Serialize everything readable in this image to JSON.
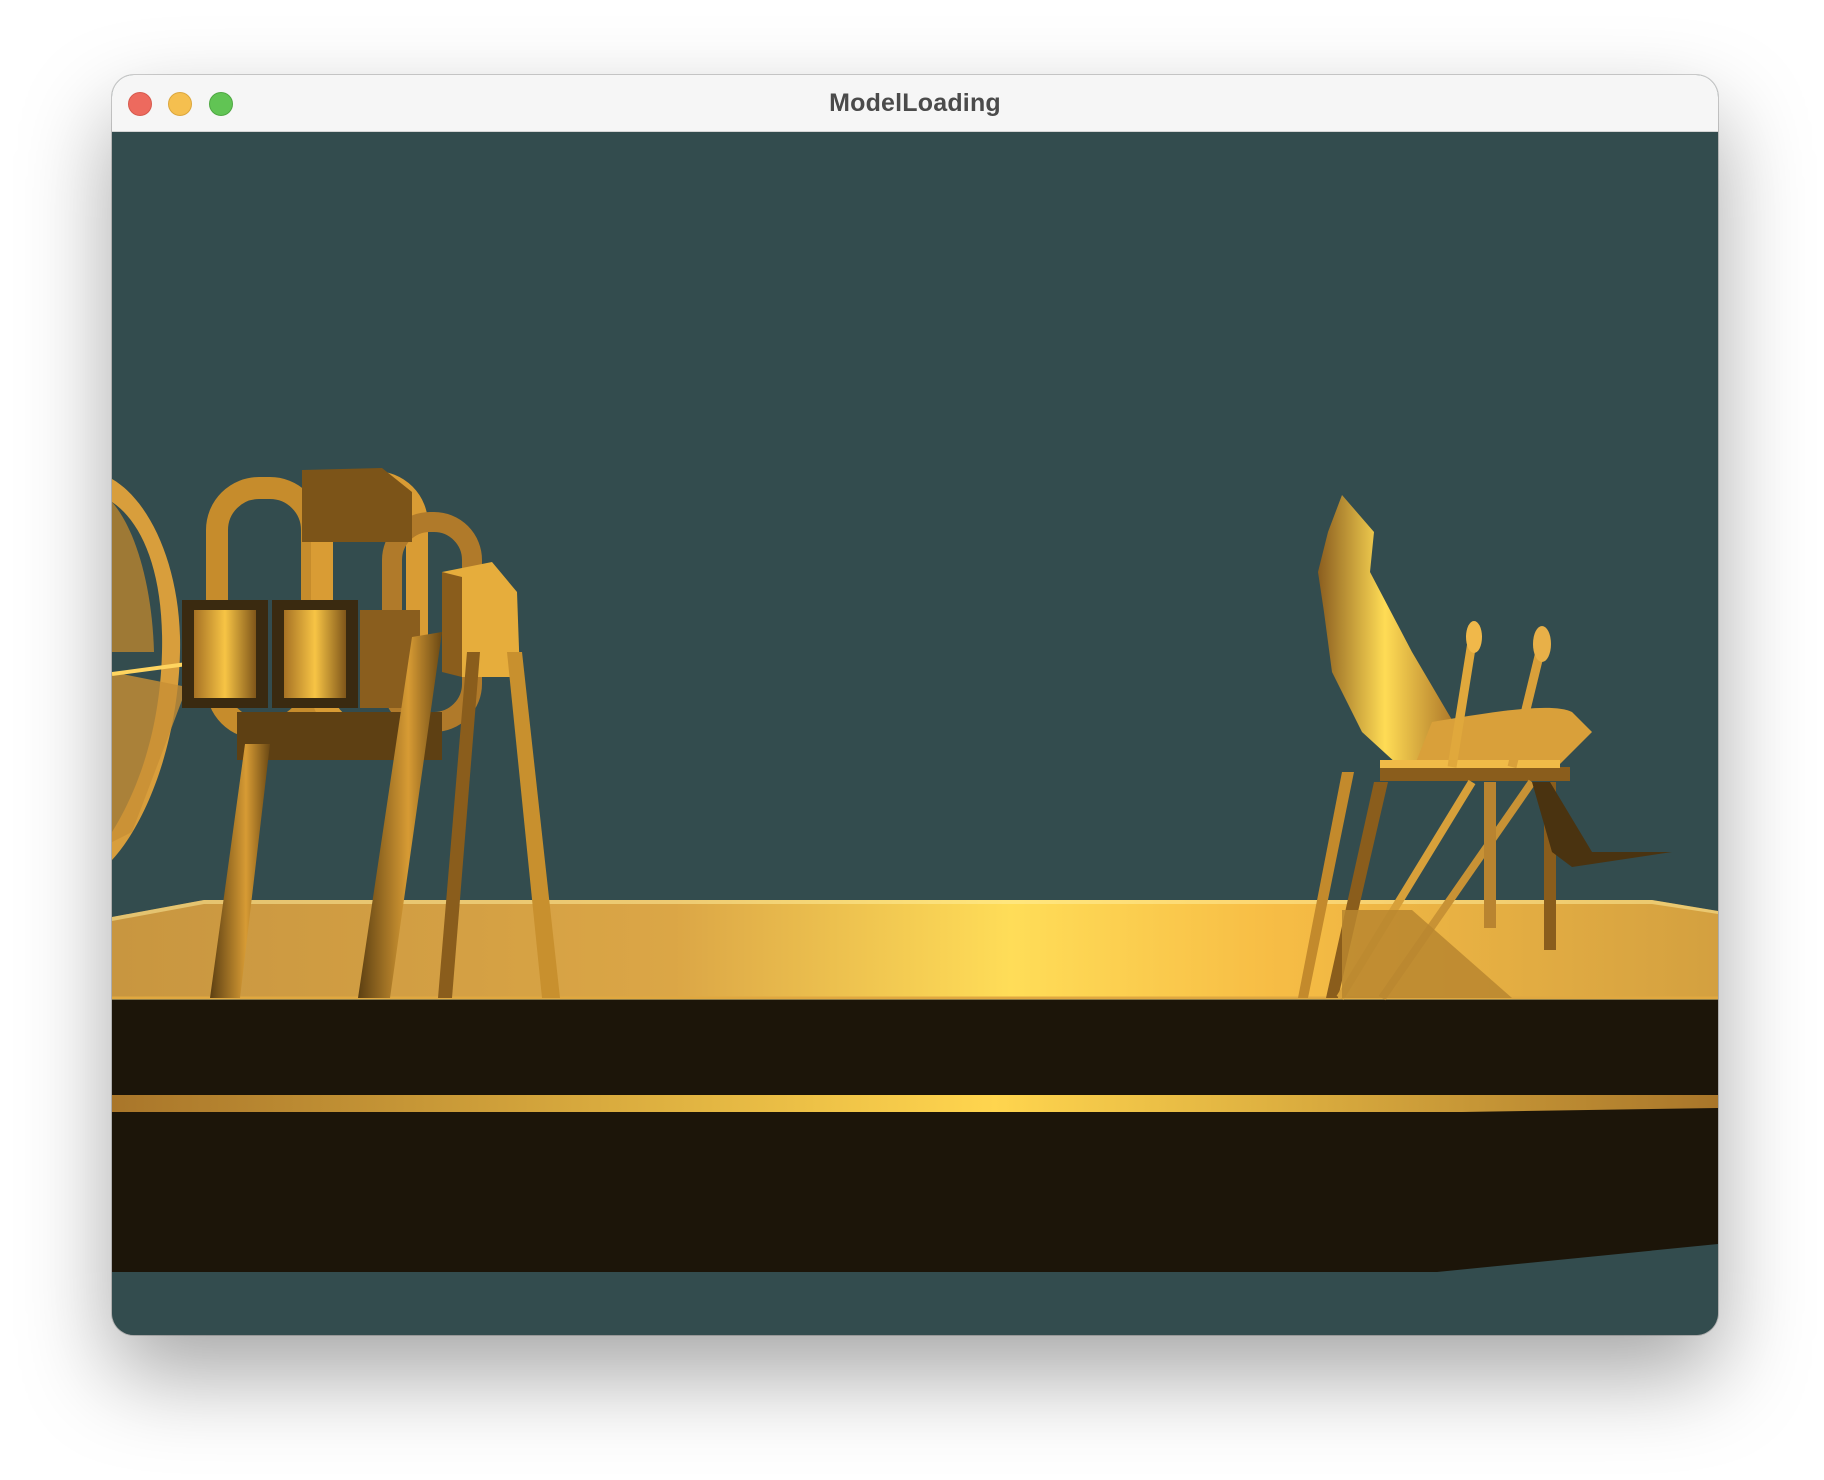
{
  "window": {
    "title": "ModelLoading",
    "controls": {
      "close": "close-button",
      "minimize": "minimize-button",
      "zoom": "zoom-button"
    }
  },
  "scene": {
    "clear_color": "#334c4e",
    "material_color": "#f0b43c",
    "highlight_color": "#ffe066",
    "shadow_color": "#1c1509",
    "model": "airboat"
  }
}
